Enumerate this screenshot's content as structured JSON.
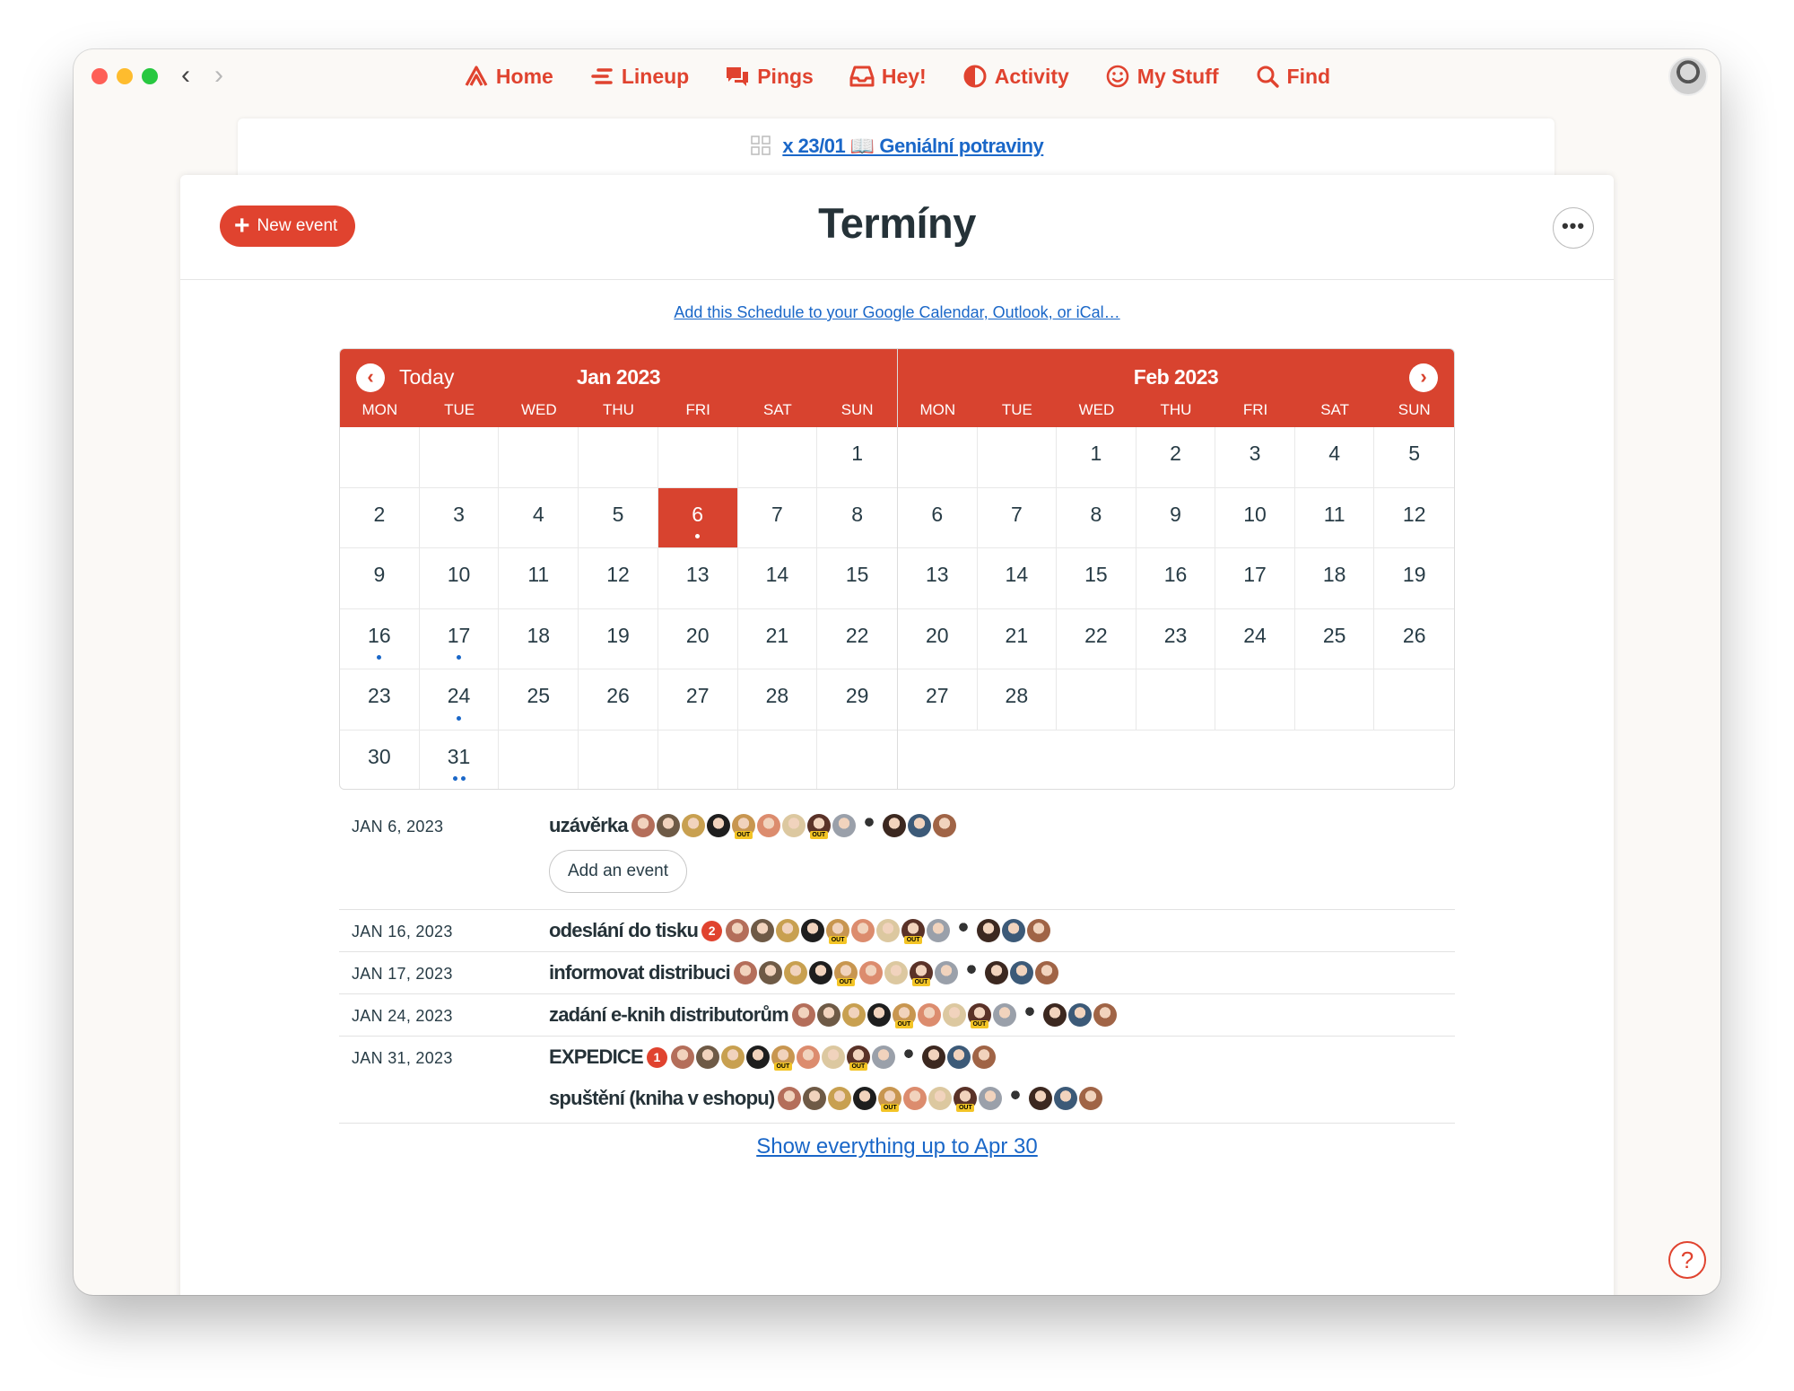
{
  "nav": {
    "items": [
      {
        "label": "Home",
        "icon": "home-icon"
      },
      {
        "label": "Lineup",
        "icon": "lineup-icon"
      },
      {
        "label": "Pings",
        "icon": "pings-icon"
      },
      {
        "label": "Hey!",
        "icon": "hey-icon"
      },
      {
        "label": "Activity",
        "icon": "activity-icon"
      },
      {
        "label": "My Stuff",
        "icon": "mystuff-icon"
      },
      {
        "label": "Find",
        "icon": "find-icon"
      }
    ],
    "back_glyph": "‹",
    "forward_glyph": "›"
  },
  "breadcrumb": {
    "project": "x 23/01 📖 Geniální potraviny"
  },
  "header": {
    "title": "Termíny",
    "new_event_label": "New event",
    "more_glyph": "•••"
  },
  "subscribe_link": "Add this Schedule to your Google Calendar, Outlook, or iCal…",
  "calendar": {
    "today_label": "Today",
    "weekdays": [
      "MON",
      "TUE",
      "WED",
      "THU",
      "FRI",
      "SAT",
      "SUN"
    ],
    "months": [
      {
        "title": "Jan 2023",
        "weeks": [
          [
            "",
            "",
            "",
            "",
            "",
            "",
            "1"
          ],
          [
            "2",
            "3",
            "4",
            "5",
            "6",
            "7",
            "8"
          ],
          [
            "9",
            "10",
            "11",
            "12",
            "13",
            "14",
            "15"
          ],
          [
            "16",
            "17",
            "18",
            "19",
            "20",
            "21",
            "22"
          ],
          [
            "23",
            "24",
            "25",
            "26",
            "27",
            "28",
            "29"
          ],
          [
            "30",
            "31",
            "",
            "",
            "",
            "",
            ""
          ]
        ],
        "selected": "6",
        "event_dots": {
          "6": 1,
          "16": 1,
          "17": 1,
          "24": 1,
          "31": 2
        }
      },
      {
        "title": "Feb 2023",
        "weeks": [
          [
            "",
            "",
            "1",
            "2",
            "3",
            "4",
            "5"
          ],
          [
            "6",
            "7",
            "8",
            "9",
            "10",
            "11",
            "12"
          ],
          [
            "13",
            "14",
            "15",
            "16",
            "17",
            "18",
            "19"
          ],
          [
            "20",
            "21",
            "22",
            "23",
            "24",
            "25",
            "26"
          ],
          [
            "27",
            "28",
            "",
            "",
            "",
            "",
            ""
          ]
        ],
        "selected": "",
        "event_dots": {}
      }
    ]
  },
  "events": [
    {
      "date": "JAN 6, 2023",
      "items": [
        {
          "title": "uzávěrka",
          "badge": ""
        }
      ],
      "add_label": "Add an event"
    },
    {
      "date": "JAN 16, 2023",
      "items": [
        {
          "title": "odeslání do tisku",
          "badge": "2"
        }
      ]
    },
    {
      "date": "JAN 17, 2023",
      "items": [
        {
          "title": "informovat distribuci",
          "badge": ""
        }
      ]
    },
    {
      "date": "JAN 24, 2023",
      "items": [
        {
          "title": "zadání e-knih distributorům",
          "badge": ""
        }
      ]
    },
    {
      "date": "JAN 31, 2023",
      "items": [
        {
          "title": "EXPEDICE",
          "badge": "1"
        },
        {
          "title": "spuštění (kniha v eshopu)",
          "badge": ""
        }
      ]
    }
  ],
  "participants": [
    {
      "color": "#b46e5a",
      "out": false
    },
    {
      "color": "#6e5a46",
      "out": false
    },
    {
      "color": "#c8a050",
      "out": false
    },
    {
      "color": "#1e1e1e",
      "out": false
    },
    {
      "color": "#c89650",
      "out": true
    },
    {
      "color": "#dc8c6e",
      "out": false
    },
    {
      "color": "#dcc8a0",
      "out": false
    },
    {
      "color": "#5a3228",
      "out": true
    },
    {
      "color": "#9aa0aa",
      "out": false
    },
    {
      "color": "#ffffff",
      "out": false
    },
    {
      "color": "#3c2820",
      "out": false
    },
    {
      "color": "#3c5a78",
      "out": false
    },
    {
      "color": "#a06446",
      "out": false
    }
  ],
  "show_all_link": "Show everything up to Apr 30",
  "help_glyph": "?",
  "colors": {
    "accent": "#e0432f",
    "link": "#1a67c8"
  }
}
